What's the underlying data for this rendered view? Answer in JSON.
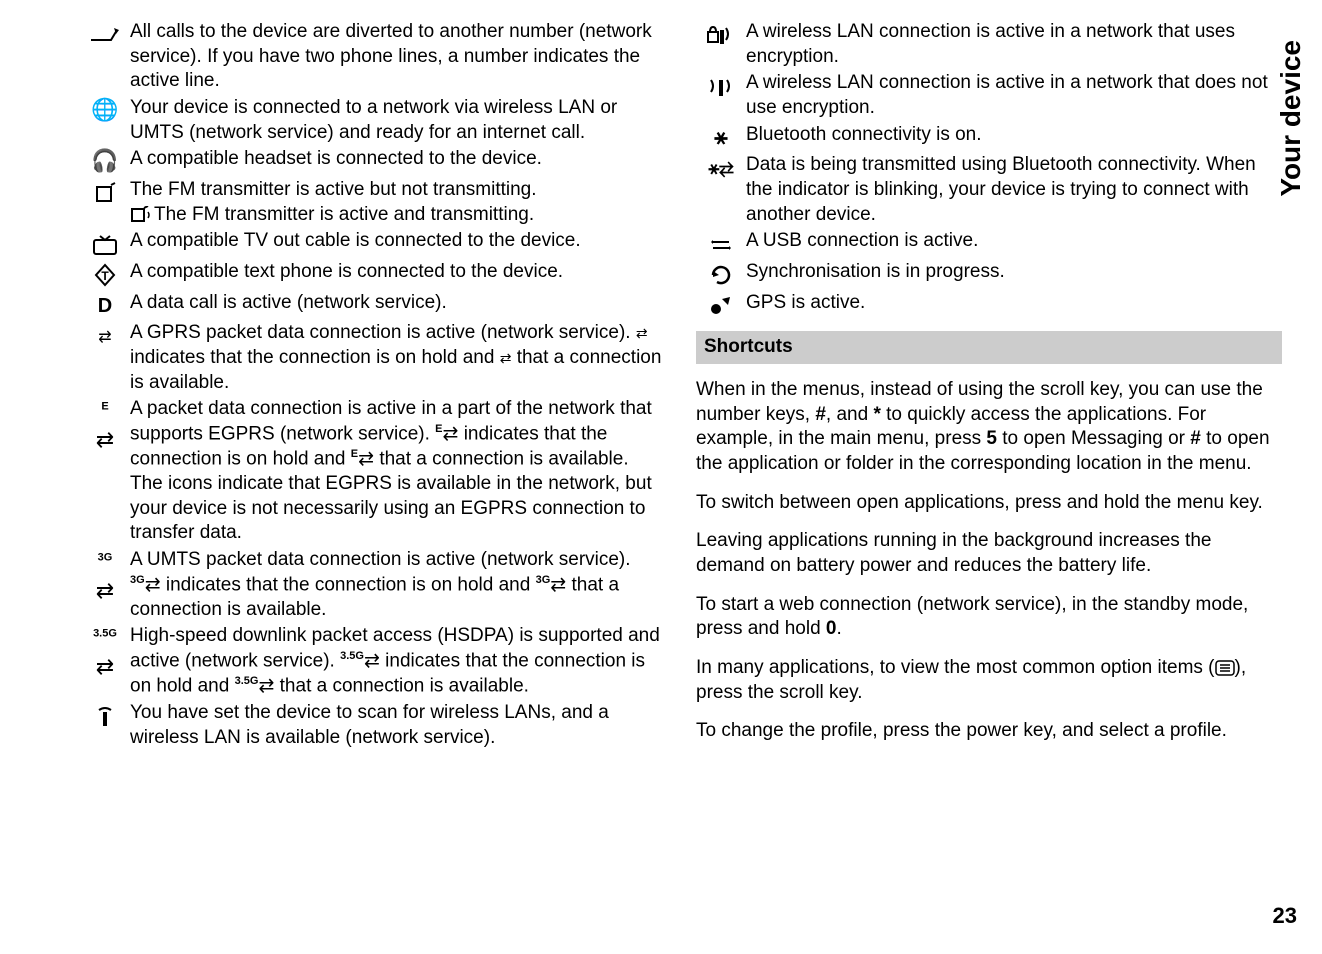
{
  "sidebar_title": "Your device",
  "page_number": "23",
  "shortcuts_heading": "Shortcuts",
  "left": {
    "divert": "All calls to the device are diverted to another number (network service). If you have two phone lines, a number indicates the active line.",
    "globe": "Your device is connected to a network via wireless LAN or UMTS (network service) and ready for an internet call.",
    "headset": "A compatible headset is connected to the device.",
    "fm1": "The FM transmitter is active but not transmitting.",
    "fm2": "The FM transmitter is active and transmitting.",
    "tv": "A compatible TV out cable is connected to the device.",
    "textphone": "A compatible text phone is connected to the device.",
    "data": "A data call is active (network service).",
    "gprs": "A GPRS packet data connection is active (network service). ",
    "gprs2": " indicates that the connection is on hold and ",
    "gprs3": " that a connection is available.",
    "egprs1": "A packet data connection is active in a part of the network that supports EGPRS (network service). ",
    "egprs2": " indicates that the connection is on hold and ",
    "egprs3": " that a connection is available. The icons indicate that EGPRS is available in the network, but your device is not necessarily using an EGPRS connection to transfer data.",
    "umts1": "A UMTS packet data connection is active (network service). ",
    "umts2": " indicates that the connection is on hold and ",
    "umts3": " that a connection is available.",
    "hsdpa1": "High-speed downlink packet access (HSDPA) is supported and active (network service). ",
    "hsdpa2": " indicates that the connection is on hold and ",
    "hsdpa3": " that a connection is available.",
    "wlan": "You have set the device to scan for wireless LANs, and a wireless LAN is available (network service)."
  },
  "right": {
    "wlanenc": "A wireless LAN connection is active in a network that uses encryption.",
    "wlannoenc": "A wireless LAN connection is active in a network that does not use encryption.",
    "bt": "Bluetooth connectivity is on.",
    "btdata": "Data is being transmitted using Bluetooth connectivity. When the indicator is blinking, your device is trying to connect with another device.",
    "usb": "A USB connection is active.",
    "sync": "Synchronisation is in progress.",
    "gps": "GPS is active."
  },
  "paras": {
    "p1a": "When in the menus, instead of using the scroll key, you can use the number keys, ",
    "p1b": ", and ",
    "p1c": " to quickly access the applications. For example, in the main menu, press ",
    "p1d": " to open Messaging or ",
    "p1e": " to open the application or folder in the corresponding location in the menu.",
    "k_hash": "#",
    "k_star": "*",
    "k_5": "5",
    "p2": "To switch between open applications, press and hold the menu key.",
    "p3": "Leaving applications running in the background increases the demand on battery power and reduces the battery life.",
    "p4a": "To start a web connection (network service), in the standby mode, press and hold ",
    "p4b": ".",
    "k_0": "0",
    "p5a": "In many applications, to view the most common option items (",
    "p5b": "), press the scroll key.",
    "p6": "To change the profile, press the power key, and select a profile."
  }
}
